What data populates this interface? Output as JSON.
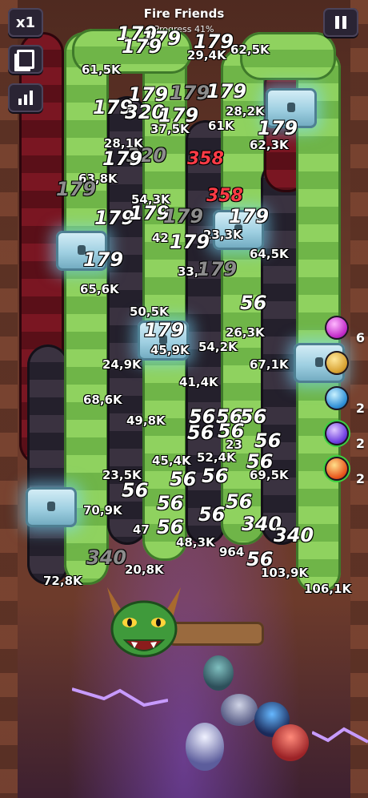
{
  "hud": {
    "speed_label": "x1",
    "level_title": "Fire Friends",
    "progress_text": "Progress 41%",
    "pause_icon": "pause-icon",
    "cards_icon": "cards-icon",
    "stats_icon": "bar-chart-icon"
  },
  "damage_numbers": [
    "179",
    "179",
    "179",
    "179",
    "61,5K",
    "29,4K",
    "62,5K",
    "179",
    "179",
    "179",
    "28,2K",
    "179",
    "320",
    "179",
    "37,5K",
    "61K",
    "179",
    "62,3K",
    "28,1K",
    "320",
    "358",
    "179",
    "63,8K",
    "179",
    "54,3K",
    "358",
    "179",
    "179",
    "179",
    "179",
    "42",
    "23,3K",
    "179",
    "179",
    "64,5K",
    "33,1",
    "179",
    "65,6K",
    "56",
    "50,5K",
    "179",
    "26,3K",
    "45,9K",
    "54,2K",
    "24,9K",
    "67,1K",
    "41,4K",
    "68,6K",
    "49,8K",
    "56",
    "56",
    "56",
    "56",
    "56",
    "23",
    "56",
    "45,4K",
    "52,4K",
    "56",
    "23,5K",
    "56",
    "56",
    "69,5K",
    "56",
    "56",
    "56",
    "70,9K",
    "47",
    "56",
    "56",
    "340",
    "340",
    "48,3K",
    "964",
    "56",
    "340",
    "20,8K",
    "72,8K",
    "103,9K",
    "106,1K"
  ],
  "skills": [
    {
      "name": "pink-orb-icon",
      "count": "6"
    },
    {
      "name": "gold-coin-icon",
      "count": ""
    },
    {
      "name": "ice-shard-icon",
      "count": "2"
    },
    {
      "name": "lightning-orb-icon",
      "count": "2"
    },
    {
      "name": "fire-orb-icon",
      "count": "2"
    }
  ],
  "colors": {
    "green_snake": "#8fd25f",
    "dark_snake": "#2e2836",
    "red_snake": "#6c1320",
    "crit": "#ff3b46",
    "hud_button": "#2a2434"
  }
}
